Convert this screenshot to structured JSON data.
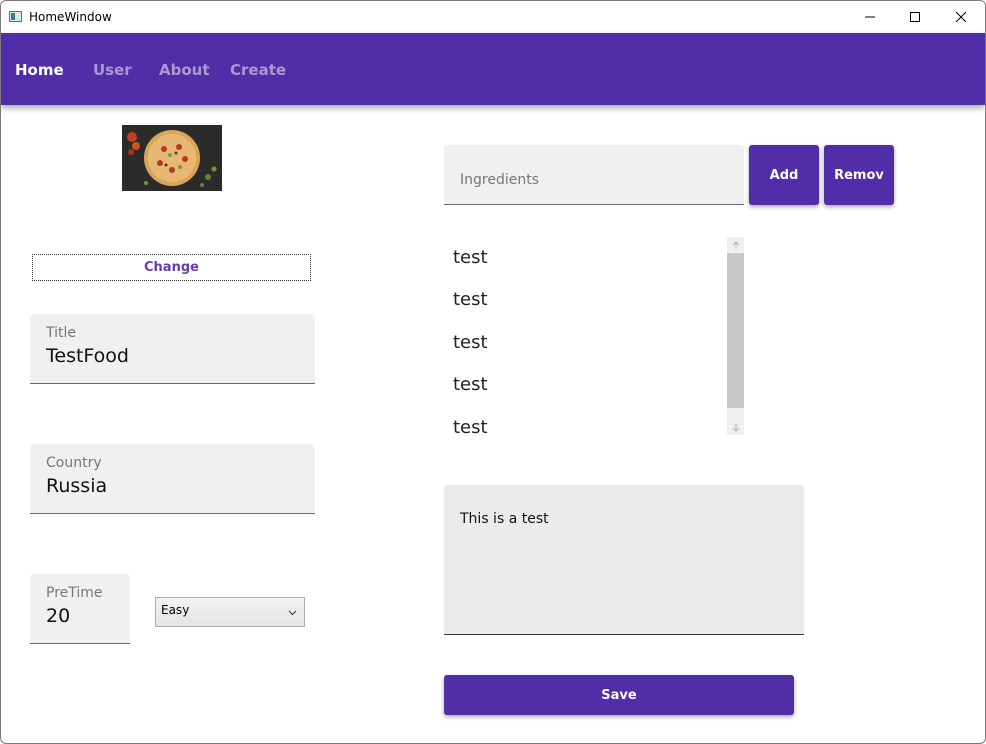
{
  "window": {
    "title": "HomeWindow"
  },
  "nav": {
    "items": [
      {
        "label": "Home",
        "active": true
      },
      {
        "label": "User",
        "active": false
      },
      {
        "label": "About",
        "active": false
      },
      {
        "label": "Create",
        "active": false
      }
    ]
  },
  "recipe": {
    "image_icon": "pizza-photo",
    "change_label": "Change",
    "title": {
      "label": "Title",
      "value": "TestFood"
    },
    "country": {
      "label": "Country",
      "value": "Russia"
    },
    "pretime": {
      "label": "PreTime",
      "value": "20"
    },
    "difficulty": {
      "selected": "Easy"
    }
  },
  "ingredients": {
    "placeholder": "Ingredients",
    "add_label": "Add",
    "remove_label": "Remov",
    "items": [
      "test",
      "test",
      "test",
      "test",
      "test"
    ]
  },
  "description": {
    "text": "This is a test"
  },
  "save_label": "Save",
  "colors": {
    "primary": "#512da8",
    "nav_inactive": "#a99bd2",
    "change_text": "#673ab7"
  }
}
